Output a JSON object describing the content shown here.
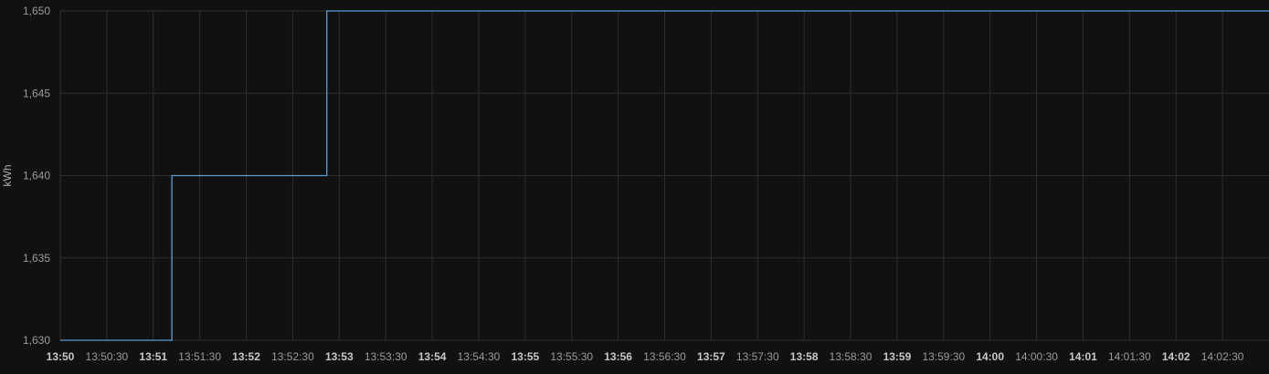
{
  "chart_data": {
    "type": "line",
    "step": true,
    "ylabel": "kWh",
    "xlabel": "",
    "title": "",
    "ylim": [
      1630,
      1650
    ],
    "yticks": [
      "1,630",
      "1,635",
      "1,640",
      "1,645",
      "1,650"
    ],
    "ytick_values": [
      1630,
      1635,
      1640,
      1645,
      1650
    ],
    "xlim": [
      "13:50:00",
      "14:03:00"
    ],
    "xticks": [
      {
        "time": "13:50:00",
        "label": "13:50",
        "major": true
      },
      {
        "time": "13:50:30",
        "label": "13:50:30",
        "major": false
      },
      {
        "time": "13:51:00",
        "label": "13:51",
        "major": true
      },
      {
        "time": "13:51:30",
        "label": "13:51:30",
        "major": false
      },
      {
        "time": "13:52:00",
        "label": "13:52",
        "major": true
      },
      {
        "time": "13:52:30",
        "label": "13:52:30",
        "major": false
      },
      {
        "time": "13:53:00",
        "label": "13:53",
        "major": true
      },
      {
        "time": "13:53:30",
        "label": "13:53:30",
        "major": false
      },
      {
        "time": "13:54:00",
        "label": "13:54",
        "major": true
      },
      {
        "time": "13:54:30",
        "label": "13:54:30",
        "major": false
      },
      {
        "time": "13:55:00",
        "label": "13:55",
        "major": true
      },
      {
        "time": "13:55:30",
        "label": "13:55:30",
        "major": false
      },
      {
        "time": "13:56:00",
        "label": "13:56",
        "major": true
      },
      {
        "time": "13:56:30",
        "label": "13:56:30",
        "major": false
      },
      {
        "time": "13:57:00",
        "label": "13:57",
        "major": true
      },
      {
        "time": "13:57:30",
        "label": "13:57:30",
        "major": false
      },
      {
        "time": "13:58:00",
        "label": "13:58",
        "major": true
      },
      {
        "time": "13:58:30",
        "label": "13:58:30",
        "major": false
      },
      {
        "time": "13:59:00",
        "label": "13:59",
        "major": true
      },
      {
        "time": "13:59:30",
        "label": "13:59:30",
        "major": false
      },
      {
        "time": "14:00:00",
        "label": "14:00",
        "major": true
      },
      {
        "time": "14:00:30",
        "label": "14:00:30",
        "major": false
      },
      {
        "time": "14:01:00",
        "label": "14:01",
        "major": true
      },
      {
        "time": "14:01:30",
        "label": "14:01:30",
        "major": false
      },
      {
        "time": "14:02:00",
        "label": "14:02",
        "major": true
      },
      {
        "time": "14:02:30",
        "label": "14:02:30",
        "major": false
      }
    ],
    "grid": true,
    "series": [
      {
        "color": "#5b9bd5",
        "points": [
          {
            "x": "13:50:00",
            "y": 1630
          },
          {
            "x": "13:51:12",
            "y": 1640
          },
          {
            "x": "13:52:52",
            "y": 1650
          },
          {
            "x": "14:03:00",
            "y": 1650
          }
        ]
      }
    ],
    "colors": {
      "background": "#111111",
      "grid": "#2e2e2e"
    }
  }
}
